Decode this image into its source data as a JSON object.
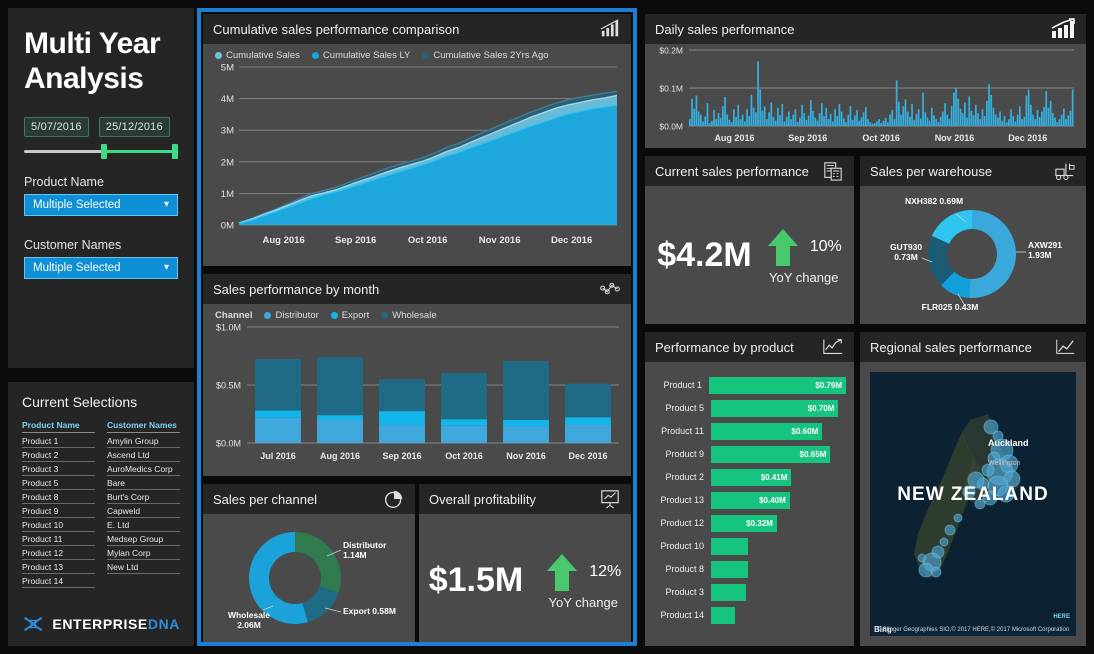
{
  "sidebar": {
    "title_line1": "Multi Year",
    "title_line2": "Analysis",
    "date_from": "5/07/2016",
    "date_to": "25/12/2016",
    "product_slicer": {
      "label": "Product Name",
      "value": "Multiple Selected",
      "chevron": "chevron-down-icon"
    },
    "customer_slicer": {
      "label": "Customer Names",
      "value": "Multiple Selected",
      "chevron": "chevron-down-icon"
    }
  },
  "selections": {
    "title": "Current Selections",
    "col1_header": "Product Name",
    "col2_header": "Customer Names",
    "products": [
      "Product 1",
      "Product 2",
      "Product 3",
      "Product 5",
      "Product 8",
      "Product 9",
      "Product 10",
      "Product 11",
      "Product 12",
      "Product 13",
      "Product 14"
    ],
    "customers": [
      "Amylin Group",
      "Ascend Ltd",
      "AuroMedics Corp",
      "Bare",
      "Burt's Corp",
      "Capweld",
      "E. Ltd",
      "Medsep Group",
      "Mylan Corp",
      "New Ltd"
    ],
    "logo_primary": "ENTERPRISE",
    "logo_secondary": "DNA"
  },
  "panels": {
    "cumulative": {
      "title": "Cumulative sales performance comparison",
      "icon": "bar-chart-trend-icon"
    },
    "monthly": {
      "title": "Sales performance by month",
      "icon": "scatter-network-icon"
    },
    "channel": {
      "title": "Sales per channel",
      "icon": "pie-chart-icon"
    },
    "profitability": {
      "title": "Overall profitability",
      "icon": "presentation-chart-icon"
    },
    "daily": {
      "title": "Daily sales performance",
      "icon": "bar-chart-arrow-icon"
    },
    "current_sales": {
      "title": "Current sales performance",
      "icon": "invoice-calculator-icon"
    },
    "warehouse": {
      "title": "Sales per warehouse",
      "icon": "forklift-icon"
    },
    "product_perf": {
      "title": "Performance by product",
      "icon": "line-chart-icon"
    },
    "regional": {
      "title": "Regional sales performance",
      "icon": "trend-line-icon"
    }
  },
  "kpi_current": {
    "value": "$4.2M",
    "pct": "10%",
    "sub": "YoY change",
    "arrow": "up-arrow-icon",
    "color": "#49c96d"
  },
  "kpi_profit": {
    "value": "$1.5M",
    "pct": "12%",
    "sub": "YoY change",
    "arrow": "up-arrow-icon",
    "color": "#49c96d"
  },
  "chart_data": [
    {
      "id": "cumulative",
      "type": "area",
      "title": "Cumulative sales performance comparison",
      "xlabel": "",
      "ylabel": "",
      "ylim": [
        0,
        5000000
      ],
      "ytick_labels": [
        "0M",
        "1M",
        "2M",
        "3M",
        "4M",
        "5M"
      ],
      "xtick_labels": [
        "Aug 2016",
        "Sep 2016",
        "Oct 2016",
        "Nov 2016",
        "Dec 2016"
      ],
      "grid": true,
      "legend_position": "top-left",
      "series": [
        {
          "name": "Cumulative Sales",
          "color": "#6fc2dd",
          "values": [
            60000,
            180000,
            330000,
            470000,
            620000,
            780000,
            930000,
            1020000,
            1120000,
            1260000,
            1400000,
            1520000,
            1660000,
            1790000,
            1900000,
            2010000,
            2150000,
            2320000,
            2450000,
            2620000,
            2780000,
            2940000,
            3100000,
            3260000,
            3420000,
            3560000,
            3700000,
            3800000,
            3880000,
            3960000,
            4020000,
            4100000
          ]
        },
        {
          "name": "Cumulative Sales LY",
          "color": "#17a5dc",
          "values": [
            50000,
            150000,
            290000,
            420000,
            560000,
            700000,
            850000,
            960000,
            1060000,
            1180000,
            1300000,
            1420000,
            1550000,
            1670000,
            1790000,
            1900000,
            2030000,
            2180000,
            2300000,
            2440000,
            2580000,
            2720000,
            2860000,
            3000000,
            3140000,
            3260000,
            3400000,
            3510000,
            3600000,
            3680000,
            3740000,
            3800000
          ]
        },
        {
          "name": "Cumulative Sales 2Yrs Ago",
          "color": "#2b5f76",
          "values": [
            70000,
            200000,
            360000,
            500000,
            670000,
            840000,
            1000000,
            1090000,
            1200000,
            1350000,
            1500000,
            1630000,
            1780000,
            1900000,
            2010000,
            2120000,
            2270000,
            2450000,
            2580000,
            2760000,
            2930000,
            3090000,
            3260000,
            3420000,
            3580000,
            3720000,
            3860000,
            3960000,
            4040000,
            4110000,
            4170000,
            4230000
          ]
        }
      ]
    },
    {
      "id": "monthly",
      "type": "bar",
      "title": "Sales performance by month",
      "stacked": true,
      "legend_title": "Channel",
      "categories": [
        "Jul 2016",
        "Aug 2016",
        "Sep 2016",
        "Oct 2016",
        "Nov 2016",
        "Dec 2016"
      ],
      "ytick_labels": [
        "$0.0M",
        "$0.5M",
        "$1.0M"
      ],
      "ylim": [
        0,
        1000000
      ],
      "grid": true,
      "series": [
        {
          "name": "Distributor",
          "color": "#3fa9dd",
          "values": [
            218000,
            198000,
            155000,
            148000,
            143000,
            160000
          ]
        },
        {
          "name": "Export",
          "color": "#13b5ea",
          "values": [
            62000,
            42000,
            120000,
            57000,
            55000,
            62000
          ]
        },
        {
          "name": "Wholesale",
          "color": "#1f6b85",
          "values": [
            445000,
            500000,
            275000,
            400000,
            510000,
            290000
          ]
        }
      ]
    },
    {
      "id": "channel",
      "type": "pie",
      "title": "Sales per channel",
      "donut": true,
      "labels": [
        "Distributor",
        "Export",
        "Wholesale"
      ],
      "values": [
        1.14,
        0.58,
        2.06
      ],
      "value_labels": [
        "Distributor\n1.14M",
        "Export 0.58M",
        "Wholesale\n2.06M"
      ],
      "colors": [
        "#2f7a4f",
        "#1f6b85",
        "#1ca2da"
      ]
    },
    {
      "id": "daily",
      "type": "bar",
      "title": "Daily sales performance",
      "ylim": [
        0,
        200000
      ],
      "ytick_labels": [
        "$0.0M",
        "$0.1M",
        "$0.2M"
      ],
      "xtick_labels": [
        "Aug 2016",
        "Sep 2016",
        "Oct 2016",
        "Nov 2016",
        "Dec 2016"
      ],
      "color": "#35b0e0",
      "grid": true,
      "values": [
        18,
        72,
        46,
        80,
        38,
        30,
        12,
        25,
        60,
        8,
        14,
        42,
        18,
        34,
        22,
        52,
        76,
        30,
        16,
        10,
        44,
        24,
        56,
        18,
        30,
        12,
        44,
        26,
        82,
        48,
        36,
        170,
        96,
        40,
        52,
        18,
        36,
        62,
        24,
        14,
        48,
        28,
        58,
        12,
        24,
        38,
        18,
        30,
        44,
        10,
        22,
        56,
        34,
        16,
        28,
        68,
        40,
        22,
        14,
        34,
        60,
        26,
        48,
        18,
        32,
        12,
        44,
        26,
        58,
        38,
        20,
        10,
        30,
        52,
        16,
        28,
        42,
        14,
        22,
        36,
        50,
        18,
        10,
        6,
        8,
        12,
        18,
        8,
        14,
        22,
        10,
        30,
        42,
        18,
        120,
        64,
        30,
        52,
        70,
        38,
        24,
        58,
        16,
        32,
        44,
        20,
        88,
        36,
        22,
        14,
        48,
        28,
        18,
        10,
        24,
        38,
        60,
        30,
        18,
        52,
        88,
        100,
        72,
        46,
        34,
        62,
        22,
        78,
        40,
        28,
        56,
        34,
        18,
        44,
        26,
        66,
        110,
        82,
        48,
        30,
        22,
        38,
        14,
        26,
        10,
        18,
        44,
        26,
        12,
        30,
        52,
        18,
        24,
        80,
        96,
        56,
        30,
        18,
        42,
        24,
        38,
        50,
        92,
        48,
        66,
        34,
        22,
        10,
        18,
        30,
        46,
        18,
        28,
        40,
        96
      ]
    },
    {
      "id": "warehouse",
      "type": "pie",
      "title": "Sales per warehouse",
      "donut": true,
      "labels": [
        "AXW291",
        "FLR025",
        "GUT930",
        "NXH382"
      ],
      "values": [
        1.93,
        0.43,
        0.73,
        0.69
      ],
      "value_labels": [
        "AXW291\n1.93M",
        "FLR025 0.43M",
        "GUT930\n0.73M",
        "NXH382 0.69M"
      ],
      "colors": [
        "#3aa8da",
        "#12a0da",
        "#1d5a73",
        "#2ec6f0"
      ]
    },
    {
      "id": "product_perf",
      "type": "bar",
      "orientation": "horizontal",
      "title": "Performance by product",
      "color": "#16c47f",
      "categories": [
        "Product 1",
        "Product 5",
        "Product 11",
        "Product 9",
        "Product 2",
        "Product 13",
        "Product 12",
        "Product 10",
        "Product 8",
        "Product 3",
        "Product 14"
      ],
      "values": [
        0.79,
        0.7,
        0.6,
        0.65,
        0.41,
        0.4,
        0.32,
        0.14,
        0.14,
        0.13,
        0.06
      ],
      "value_labels": [
        "$0.79M",
        "$0.70M",
        "$0.60M",
        "$0.65M",
        "$0.41M",
        "$0.40M",
        "$0.32M",
        "",
        "",
        "",
        ""
      ]
    },
    {
      "id": "regional",
      "type": "map",
      "title": "Regional sales performance",
      "region": "NEW ZEALAND",
      "city_labels": [
        "Auckland",
        "Wellington"
      ],
      "attribution": "© Blinger Geographies SIO,© 2017 HERE,© 2017 Microsoft Corporation",
      "provider": "Bing",
      "provider_secondary": "HERE",
      "bubble_color": "#4fa9d8"
    }
  ]
}
